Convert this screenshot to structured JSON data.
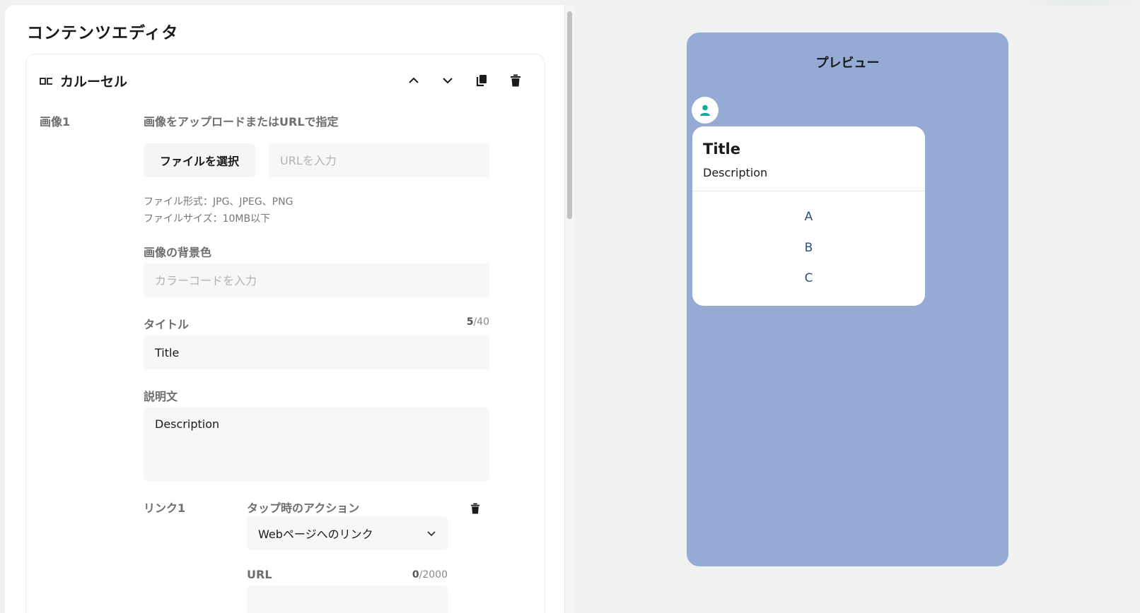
{
  "editor": {
    "title": "コンテンツエディタ",
    "block": {
      "title": "カルーセル",
      "image_label": "画像1",
      "upload": {
        "label": "画像をアップロードまたはURLで指定",
        "file_button": "ファイルを選択",
        "url_placeholder": "URLを入力",
        "hint_format": "ファイル形式：JPG、JPEG、PNG",
        "hint_size": "ファイルサイズ：10MB以下"
      },
      "bg_color": {
        "label": "画像の背景色",
        "placeholder": "カラーコードを入力"
      },
      "title_field": {
        "label": "タイトル",
        "value": "Title",
        "count": "5",
        "max": "/40"
      },
      "description_field": {
        "label": "説明文",
        "value": "Description"
      },
      "link": {
        "label": "リンク1",
        "action_label": "タップ時のアクション",
        "action_value": "Webページへのリンク",
        "url_label": "URL",
        "url_count": "0",
        "url_max": "/2000"
      }
    }
  },
  "preview": {
    "title": "プレビュー",
    "card": {
      "title": "Title",
      "description": "Description",
      "actions": [
        "A",
        "B",
        "C"
      ]
    }
  },
  "colors": {
    "preview_bg": "#95abd4",
    "avatar_icon": "#14a89a",
    "action_text": "#2c4f7c"
  },
  "icons": [
    "carousel-icon",
    "chevron-up-icon",
    "chevron-down-icon",
    "copy-icon",
    "trash-icon",
    "user-icon"
  ]
}
